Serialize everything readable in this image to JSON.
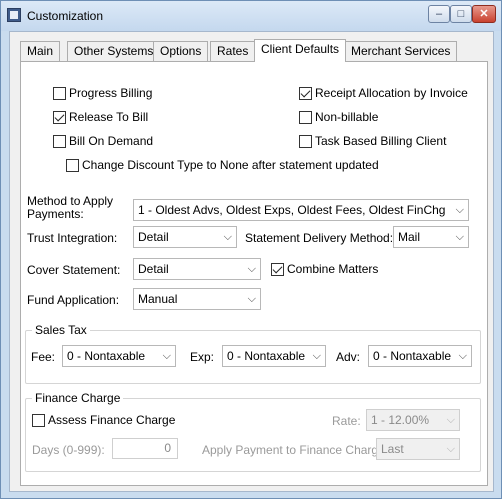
{
  "window": {
    "title": "Customization",
    "minimize": "–",
    "maximize": "□",
    "close": "✕"
  },
  "tabs": [
    "Main",
    "Other Systems",
    "Options",
    "Rates",
    "Client Defaults",
    "Merchant Services"
  ],
  "active_tab": "Client Defaults",
  "checkboxes": {
    "progress_billing": {
      "label": "Progress Billing",
      "checked": false
    },
    "receipt_allocation": {
      "label": "Receipt Allocation by Invoice",
      "checked": true
    },
    "release_to_bill": {
      "label": "Release To Bill",
      "checked": true
    },
    "non_billable": {
      "label": "Non-billable",
      "checked": false
    },
    "bill_on_demand": {
      "label": "Bill On Demand",
      "checked": false
    },
    "task_based": {
      "label": "Task Based Billing Client",
      "checked": false
    },
    "change_discount": {
      "label": "Change Discount Type to None after statement updated",
      "checked": false
    },
    "combine_matters": {
      "label": "Combine Matters",
      "checked": true
    },
    "assess_finance": {
      "label": "Assess Finance Charge",
      "checked": false
    }
  },
  "fields": {
    "method_label_1": "Method to Apply",
    "method_label_2": "Payments:",
    "method_value": "1 - Oldest Advs, Oldest Exps, Oldest Fees, Oldest FinChg",
    "trust_label": "Trust Integration:",
    "trust_value": "Detail",
    "delivery_label": "Statement Delivery Method:",
    "delivery_value": "Mail",
    "cover_label": "Cover Statement:",
    "cover_value": "Detail",
    "fund_label": "Fund Application:",
    "fund_value": "Manual"
  },
  "sales_tax": {
    "title": "Sales Tax",
    "fee_label": "Fee:",
    "fee_value": "0 - Nontaxable",
    "exp_label": "Exp:",
    "exp_value": "0 - Nontaxable",
    "adv_label": "Adv:",
    "adv_value": "0 - Nontaxable"
  },
  "finance_charge": {
    "title": "Finance Charge",
    "rate_label": "Rate:",
    "rate_value": "1 - 12.00%",
    "days_label": "Days (0-999):",
    "days_value": "0",
    "apply_label": "Apply Payment to Finance Charge:",
    "apply_value": "Last"
  },
  "icons": {
    "dropdown": "chevron-down-icon",
    "app": "app-icon"
  }
}
